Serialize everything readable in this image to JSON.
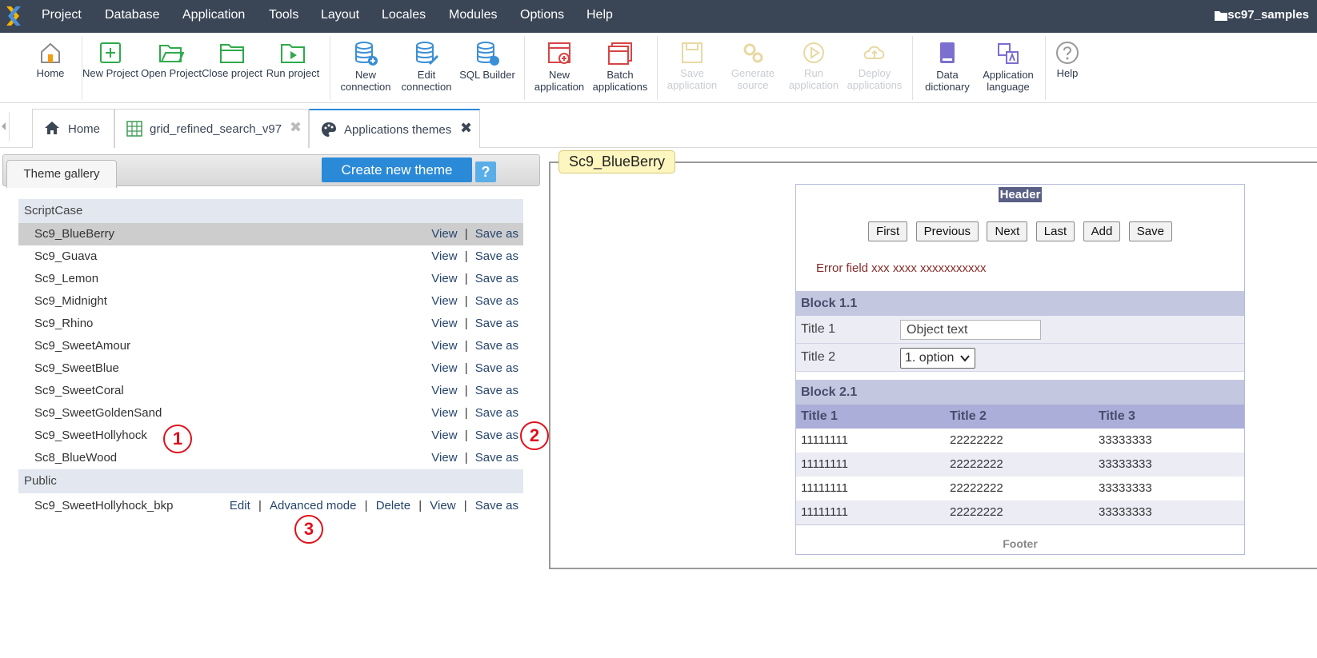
{
  "menubar": {
    "items": [
      "Project",
      "Database",
      "Application",
      "Tools",
      "Layout",
      "Locales",
      "Modules",
      "Options",
      "Help"
    ],
    "project_name": "sc97_samples"
  },
  "toolbar": {
    "home": "Home",
    "new_project": "New Project",
    "open_project": "Open Project",
    "close_project": "Close project",
    "run_project": "Run project",
    "new_connection": "New connection",
    "edit_connection": "Edit connection",
    "sql_builder": "SQL Builder",
    "new_application": "New application",
    "batch_applications": "Batch applications",
    "save_application": "Save application",
    "generate_source": "Generate source",
    "run_application": "Run application",
    "deploy_applications": "Deploy applications",
    "data_dictionary": "Data dictionary",
    "application_language": "Application language",
    "help": "Help"
  },
  "tabs": [
    {
      "label": "Home"
    },
    {
      "label": "grid_refined_search_v97",
      "close": "✖"
    },
    {
      "label": "Applications themes",
      "close": "✖"
    }
  ],
  "gallery": {
    "tab_label": "Theme gallery",
    "create_button": "Create new theme",
    "help_button": "?"
  },
  "themes": {
    "scriptcase_group": "ScriptCase",
    "scriptcase": [
      "Sc9_BlueBerry",
      "Sc9_Guava",
      "Sc9_Lemon",
      "Sc9_Midnight",
      "Sc9_Rhino",
      "Sc9_SweetAmour",
      "Sc9_SweetBlue",
      "Sc9_SweetCoral",
      "Sc9_SweetGoldenSand",
      "Sc9_SweetHollyhock",
      "Sc8_BlueWood"
    ],
    "public_group": "Public",
    "public": [
      "Sc9_SweetHollyhock_bkp"
    ],
    "action_view": "View",
    "action_save_as": "Save as",
    "action_edit": "Edit",
    "action_advanced": "Advanced mode",
    "action_delete": "Delete",
    "separator": "|"
  },
  "callouts": [
    "1",
    "2",
    "3"
  ],
  "preview": {
    "theme_name": "Sc9_BlueBerry",
    "header": "Header",
    "nav_buttons": [
      "First",
      "Previous",
      "Next",
      "Last",
      "Add",
      "Save"
    ],
    "error_text": "Error field xxx xxxx xxxxxxxxxxx",
    "block1_title": "Block 1.1",
    "field1_label": "Title 1",
    "field1_value": "Object text",
    "field2_label": "Title 2",
    "field2_value": "1. option",
    "block2_title": "Block 2.1",
    "columns": [
      "Title 1",
      "Title 2",
      "Title 3"
    ],
    "rows": [
      [
        "11111111",
        "22222222",
        "33333333"
      ],
      [
        "11111111",
        "22222222",
        "33333333"
      ],
      [
        "11111111",
        "22222222",
        "33333333"
      ],
      [
        "11111111",
        "22222222",
        "33333333"
      ]
    ],
    "footer": "Footer"
  },
  "colors": {
    "menubar_bg": "#3a4555",
    "accent": "#2b8ad8",
    "callout": "#e0101a",
    "legend_bg": "#fdf6bf"
  }
}
